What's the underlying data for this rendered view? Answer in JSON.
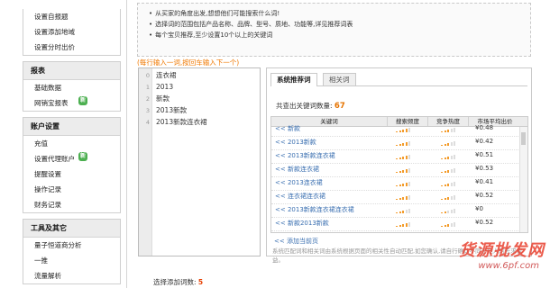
{
  "sidebar": {
    "top_items": [
      "设置自报题",
      "设置添加地域",
      "设置分时出价"
    ],
    "sections": [
      {
        "title": "报表",
        "items": [
          {
            "label": "基础数据",
            "new": false
          },
          {
            "label": "网销宝报表",
            "new": true
          }
        ]
      },
      {
        "title": "账户设置",
        "items": [
          {
            "label": "充值",
            "new": false
          },
          {
            "label": "设置代理账户",
            "new": true
          },
          {
            "label": "提醒设置",
            "new": false
          },
          {
            "label": "操作记录",
            "new": false
          },
          {
            "label": "财务记录",
            "new": false
          }
        ]
      },
      {
        "title": "工具及其它",
        "items": [
          {
            "label": "量子恒道商分析",
            "new": false
          },
          {
            "label": "一推",
            "new": false
          },
          {
            "label": "流量解析",
            "new": false
          }
        ]
      }
    ],
    "new_badge": "新"
  },
  "tips": [
    "从买家的角度出发,想想他们可能搜索什么词!",
    "选择词的范围包括产品名称、品牌、型号、质地、功能等,详见推荐词表",
    "每个宝贝推荐,至少设置10个以上的关键词"
  ],
  "editor": {
    "hint": "(每行输入一词,按回车输入下一个)",
    "lines": [
      {
        "num": "0",
        "text": "连衣裙"
      },
      {
        "num": "1",
        "text": "2013"
      },
      {
        "num": "2",
        "text": "新款"
      },
      {
        "num": "3",
        "text": "2013新款"
      },
      {
        "num": "4",
        "text": "2013新款连衣裙"
      }
    ]
  },
  "panel": {
    "tabs": [
      "系统推荐词",
      "相关词"
    ],
    "count_label": "共查出关键词数量:",
    "count_value": "67",
    "columns": [
      "关键词",
      "搜索频度",
      "竞争热度",
      "市场平均出价"
    ],
    "rows": [
      {
        "keyword": "<< 新款",
        "search": 4,
        "compete": 3,
        "price": "¥0.48"
      },
      {
        "keyword": "<< 2013新款",
        "search": 4,
        "compete": 3,
        "price": "¥0.42"
      },
      {
        "keyword": "<< 2013新款连衣裙",
        "search": 4,
        "compete": 3,
        "price": "¥0.51"
      },
      {
        "keyword": "<< 新款连衣裙",
        "search": 4,
        "compete": 3,
        "price": "¥0.53"
      },
      {
        "keyword": "<< 2013连衣裙",
        "search": 4,
        "compete": 3,
        "price": "¥0.41"
      },
      {
        "keyword": "<< 连衣裙连衣裙",
        "search": 4,
        "compete": 3,
        "price": "¥0.52"
      },
      {
        "keyword": "<< 2013新款连衣裙连衣裙",
        "search": 3,
        "compete": 2,
        "price": "¥0"
      },
      {
        "keyword": "<< 新款2013新款",
        "search": 4,
        "compete": 3,
        "price": "¥0.52"
      }
    ],
    "add_page": "<< 添加当前页",
    "note": "系统匹配词和相关词由系统根据页面的相关性自动匹配,如您确认,请自行确认不同于他人的去求权益。"
  },
  "selected": {
    "label": "选择添加词数:",
    "value": "5"
  },
  "watermark": {
    "title": "货源批发网",
    "url": "www.6pf.com"
  },
  "colors": {
    "accent": "#f07800",
    "link": "#3a6fb0",
    "bar": "#f39b2a"
  }
}
